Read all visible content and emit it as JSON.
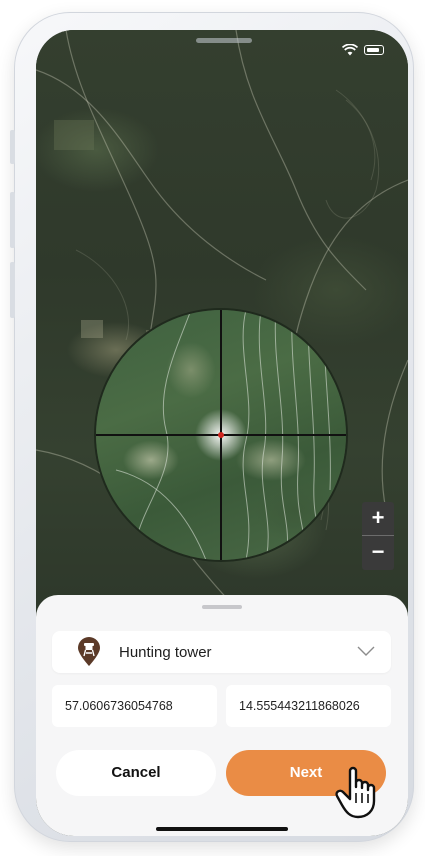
{
  "status_bar": {
    "wifi_icon": "wifi-icon",
    "battery_icon": "battery-icon"
  },
  "map": {
    "scope_center_marker_color": "#d0261f",
    "zoom_in_label": "+",
    "zoom_out_label": "−"
  },
  "location_form": {
    "type_icon": "hunting-tower-pin-icon",
    "type_label": "Hunting tower",
    "latitude": "57.0606736054768",
    "longitude": "14.555443211868026",
    "cancel_label": "Cancel",
    "next_label": "Next"
  },
  "colors": {
    "accent": "#ea8c45",
    "pin": "#5b3a28",
    "sheet_background": "#f6f6f7"
  }
}
